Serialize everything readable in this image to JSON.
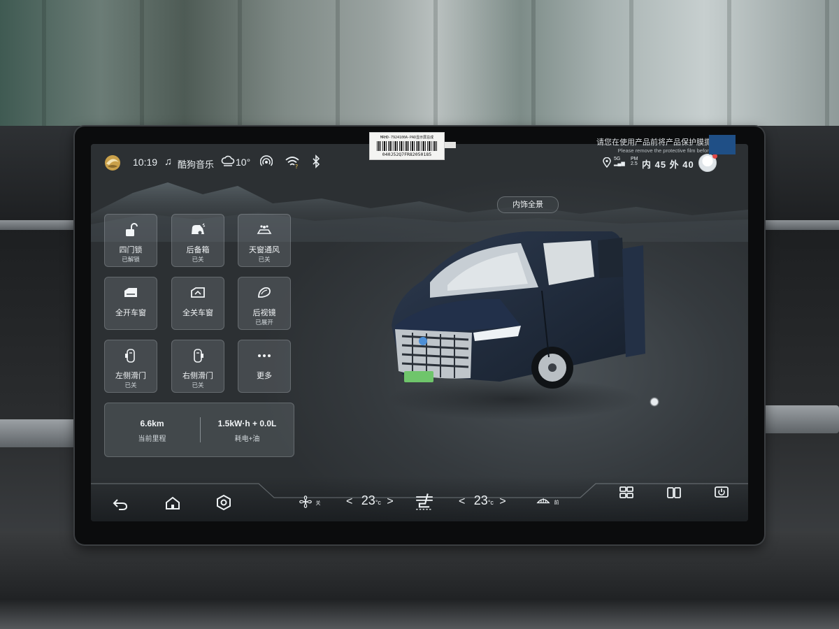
{
  "sticker": {
    "line1": "MRHD-7924100A-PAD显示屏总成",
    "line2": "040J52Q7FR82050185"
  },
  "protect_note": {
    "cn": "请您在使用产品前将产品保护膜撕掉！",
    "en": "Please remove the protective film before using!"
  },
  "status_bar": {
    "time": "10:19",
    "music_app": "酷狗音乐",
    "temperature": "10°",
    "signal_label": "5G",
    "pm_label": "PM",
    "pm_value": "2.5",
    "air_quality": "内 45 外 40"
  },
  "view_pill": "内饰全景",
  "tiles": [
    {
      "label": "四门锁",
      "status": "已解锁",
      "icon": "unlock-icon"
    },
    {
      "label": "后备箱",
      "status": "已关",
      "icon": "trunk-icon"
    },
    {
      "label": "天窗通风",
      "status": "已关",
      "icon": "sunroof-vent-icon"
    },
    {
      "label": "全开车窗",
      "status": "",
      "icon": "window-open-icon"
    },
    {
      "label": "全关车窗",
      "status": "",
      "icon": "window-close-icon"
    },
    {
      "label": "后视镜",
      "status": "已展开",
      "icon": "mirror-icon"
    },
    {
      "label": "左侧滑门",
      "status": "已关",
      "icon": "left-sliding-door-icon"
    },
    {
      "label": "右侧滑门",
      "status": "已关",
      "icon": "right-sliding-door-icon"
    },
    {
      "label": "更多",
      "status": "",
      "icon": "more-icon"
    }
  ],
  "trip": {
    "mileage_value": "6.6km",
    "mileage_label": "当前里程",
    "energy_value": "1.5kW·h + 0.0L",
    "energy_label": "耗电+油"
  },
  "dock": {
    "fan_state": "关",
    "left_temp": "23",
    "right_temp": "23",
    "temp_unit": "°c",
    "defrost_label": "前",
    "prev": "<",
    "next": ">"
  },
  "colors": {
    "screen_bg": "#353a3e",
    "tile_bg": "#6f777d",
    "text": "#f2f5f7",
    "badge_red": "#e04848"
  }
}
